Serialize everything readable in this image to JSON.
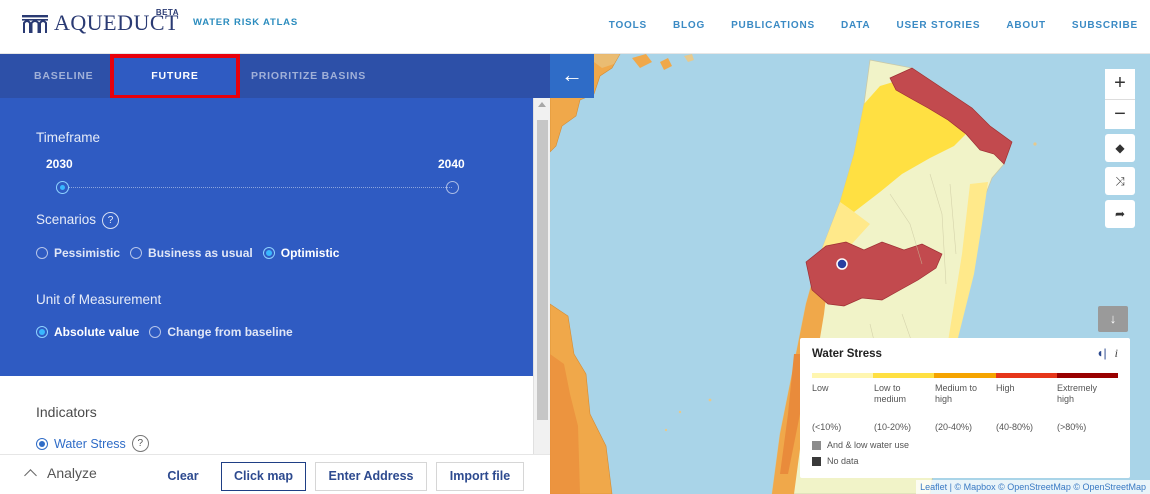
{
  "header": {
    "brand": "AQUEDUCT",
    "beta": "BETA",
    "subtitle": "WATER RISK ATLAS",
    "nav": [
      "TOOLS",
      "BLOG",
      "PUBLICATIONS",
      "DATA",
      "USER STORIES",
      "ABOUT",
      "SUBSCRIBE"
    ]
  },
  "tabs": {
    "baseline": "BASELINE",
    "future": "FUTURE",
    "prioritize": "PRIORITIZE BASINS",
    "active": "FUTURE"
  },
  "timeframe": {
    "label": "Timeframe",
    "start": "2030",
    "end": "2040",
    "selected": "2030"
  },
  "scenarios": {
    "label": "Scenarios",
    "help": "?",
    "options": [
      "Pessimistic",
      "Business as usual",
      "Optimistic"
    ],
    "selected": "Optimistic"
  },
  "unit": {
    "label": "Unit of Measurement",
    "options": [
      "Absolute value",
      "Change from baseline"
    ],
    "selected": "Absolute value"
  },
  "indicators": {
    "label": "Indicators",
    "water_stress": "Water Stress",
    "help": "?"
  },
  "bottom_bar": {
    "analyze": "Analyze",
    "clear": "Clear",
    "click_map": "Click map",
    "enter_address": "Enter Address",
    "import_file": "Import file"
  },
  "map": {
    "back_icon": "arrow-left-icon",
    "zoom_in": "+",
    "zoom_out": "−",
    "legend": {
      "title": "Water Stress",
      "categories": [
        {
          "label": "Low",
          "range": "(<10%)",
          "color": "#fff6b0"
        },
        {
          "label": "Low to medium",
          "range": "(10-20%)",
          "color": "#ffe042"
        },
        {
          "label": "Medium to high",
          "range": "(20-40%)",
          "color": "#f5a400"
        },
        {
          "label": "High",
          "range": "(40-80%)",
          "color": "#e6361a"
        },
        {
          "label": "Extremely high",
          "range": "(>80%)",
          "color": "#990000"
        }
      ],
      "arid": "And & low water use",
      "nodata": "No data"
    },
    "attribution": "Leaflet | © Mapbox © OpenStreetMap © OpenStreetMap"
  }
}
